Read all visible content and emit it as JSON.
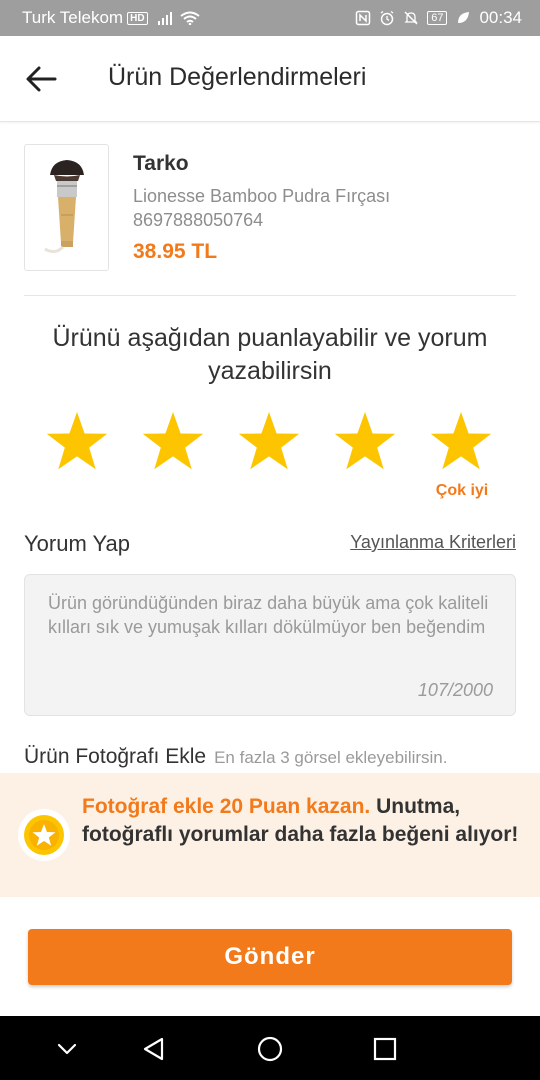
{
  "status_bar": {
    "carrier": "Turk Telekom",
    "network_badge": "HD",
    "battery": "67",
    "time": "00:34"
  },
  "app_bar": {
    "title": "Ürün Değerlendirmeleri"
  },
  "product": {
    "brand": "Tarko",
    "name": "Lionesse Bamboo Pudra Fırçası",
    "barcode": "8697888050764",
    "price": "38.95 TL"
  },
  "rating": {
    "prompt": "Ürünü aşağıdan puanlayabilir ve yorum yazabilirsin",
    "value": 5,
    "max": 5,
    "label": "Çok iyi",
    "star_color": "#fdc500"
  },
  "review": {
    "heading": "Yorum Yap",
    "criteria_link": "Yayınlanma Kriterleri",
    "text": "Ürün göründüğünden biraz daha büyük ama çok kaliteli kılları sık ve yumuşak kılları dökülmüyor ben beğendim",
    "char_count": "107/2000"
  },
  "photo": {
    "title": "Ürün Fotoğrafı Ekle",
    "hint": "En fazla 3 görsel ekleyebilirsin."
  },
  "promo": {
    "highlight": "Fotoğraf ekle 20 Puan kazan.",
    "text": " Unutma, fotoğraflı yorumlar daha fazla beğeni alıyor!",
    "icon": "star-badge-icon"
  },
  "submit": {
    "label": "Gönder"
  },
  "colors": {
    "accent": "#f27a1a",
    "star": "#fdc500",
    "promo_bg": "#fdf1e6"
  }
}
